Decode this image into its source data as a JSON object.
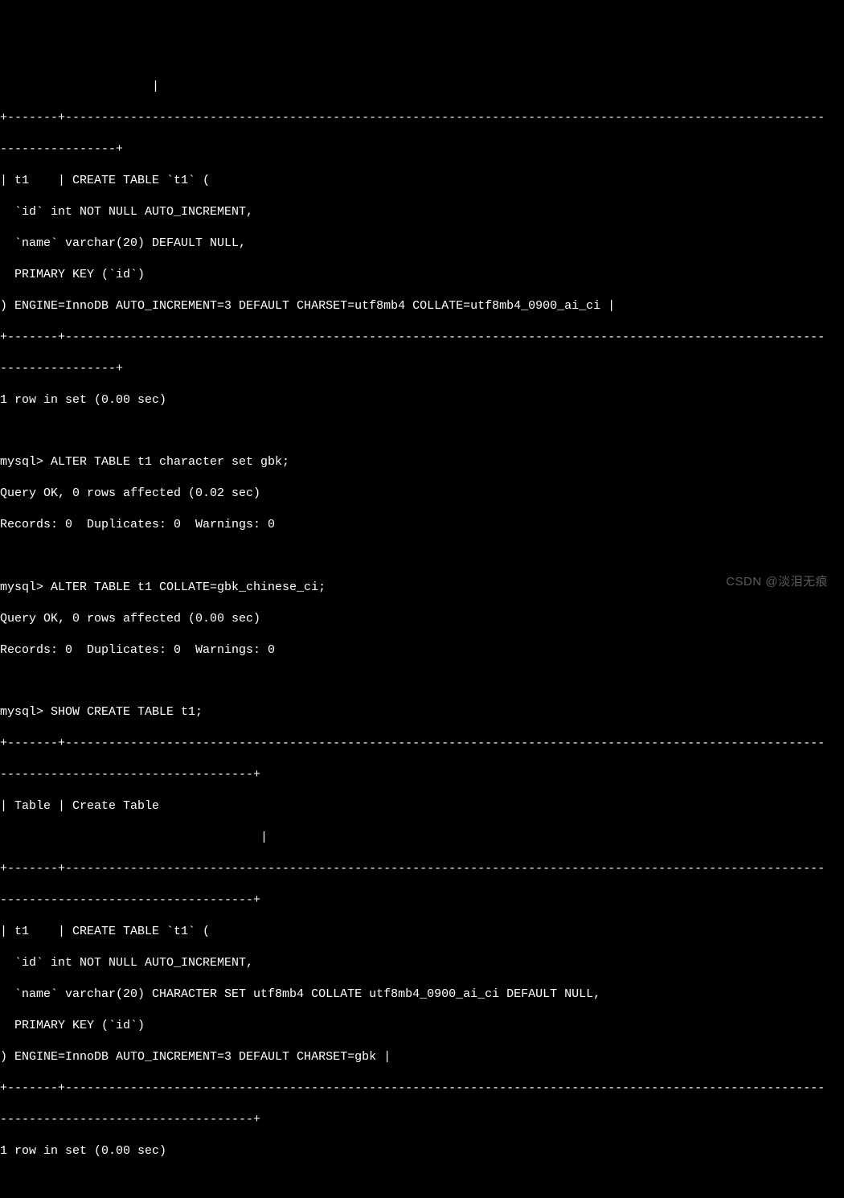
{
  "lines": {
    "l0": "                     |",
    "l1": "+-------+---------------------------------------------------------------------------------------------------------",
    "l2": "----------------+",
    "l3": "| t1    | CREATE TABLE `t1` (",
    "l4": "  `id` int NOT NULL AUTO_INCREMENT,",
    "l5": "  `name` varchar(20) DEFAULT NULL,",
    "l6": "  PRIMARY KEY (`id`)",
    "l7": ") ENGINE=InnoDB AUTO_INCREMENT=3 DEFAULT CHARSET=utf8mb4 COLLATE=utf8mb4_0900_ai_ci |",
    "l8": "+-------+---------------------------------------------------------------------------------------------------------",
    "l9": "----------------+",
    "l10": "1 row in set (0.00 sec)",
    "l11": "",
    "l12": "mysql> ALTER TABLE t1 character set gbk;",
    "l13": "Query OK, 0 rows affected (0.02 sec)",
    "l14": "Records: 0  Duplicates: 0  Warnings: 0",
    "l15": "",
    "l16": "mysql> ALTER TABLE t1 COLLATE=gbk_chinese_ci;",
    "l17": "Query OK, 0 rows affected (0.00 sec)",
    "l18": "Records: 0  Duplicates: 0  Warnings: 0",
    "l19": "",
    "l20": "mysql> SHOW CREATE TABLE t1;",
    "l21": "+-------+---------------------------------------------------------------------------------------------------------",
    "l22": "-----------------------------------+",
    "l23": "| Table | Create Table",
    "l24": "                                    |",
    "l25": "+-------+---------------------------------------------------------------------------------------------------------",
    "l26": "-----------------------------------+",
    "l27": "| t1    | CREATE TABLE `t1` (",
    "l28": "  `id` int NOT NULL AUTO_INCREMENT,",
    "l29": "  `name` varchar(20) CHARACTER SET utf8mb4 COLLATE utf8mb4_0900_ai_ci DEFAULT NULL,",
    "l30": "  PRIMARY KEY (`id`)",
    "l31": ") ENGINE=InnoDB AUTO_INCREMENT=3 DEFAULT CHARSET=gbk |",
    "l32": "+-------+---------------------------------------------------------------------------------------------------------",
    "l33": "-----------------------------------+",
    "l34": "1 row in set (0.00 sec)"
  },
  "watermark": "CSDN @淡泪无痕"
}
